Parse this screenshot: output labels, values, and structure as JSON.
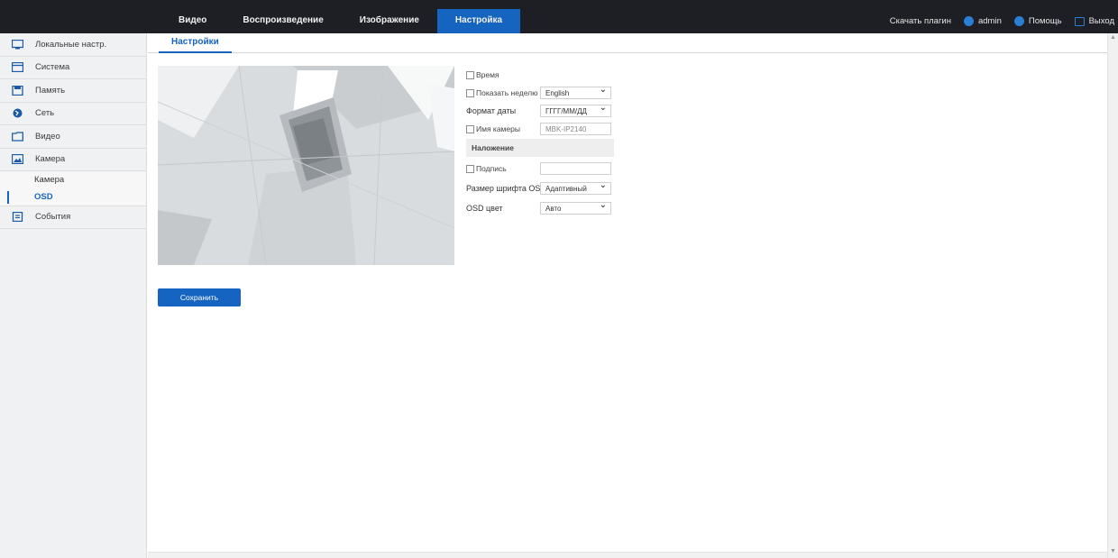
{
  "topnav": {
    "items": [
      {
        "label": "Видео"
      },
      {
        "label": "Воспроизведение"
      },
      {
        "label": "Изображение"
      },
      {
        "label": "Настройка",
        "active": true
      }
    ]
  },
  "topright": {
    "download_plugin": "Скачать плагин",
    "user": "admin",
    "help": "Помощь",
    "logout": "Выход",
    "icon_color": "#2a7fd4"
  },
  "sidebar": {
    "items": [
      {
        "label": "Локальные настр.",
        "icon": "monitor-icon"
      },
      {
        "label": "Система",
        "icon": "system-icon"
      },
      {
        "label": "Память",
        "icon": "storage-icon"
      },
      {
        "label": "Сеть",
        "icon": "network-icon"
      },
      {
        "label": "Видео",
        "icon": "video-icon"
      },
      {
        "label": "Камера",
        "icon": "camera-icon"
      }
    ],
    "subitems": [
      {
        "label": "Камера"
      },
      {
        "label": "OSD",
        "active": true
      }
    ],
    "events": {
      "label": "События",
      "icon": "events-icon"
    }
  },
  "main": {
    "tab": "Настройки",
    "form": {
      "time_label": "Время",
      "show_week_label": "Показать неделю",
      "week_lang": "English",
      "date_format_label": "Формат даты",
      "date_format": "ГГГГ/ММ/ДД",
      "camera_name_label": "Имя камеры",
      "camera_name": "MBK-IP2140",
      "overlay_section": "Наложение",
      "caption_label": "Подпись",
      "caption_value": "",
      "font_size_label": "Размер шрифта OSD",
      "font_size": "Адаптивный",
      "osd_color_label": "OSD цвет",
      "osd_color": "Авто"
    },
    "save_label": "Сохранить"
  },
  "colors": {
    "accent": "#1564c0",
    "topbar": "#1e1f24",
    "sidebar_bg": "#f0f1f2"
  }
}
